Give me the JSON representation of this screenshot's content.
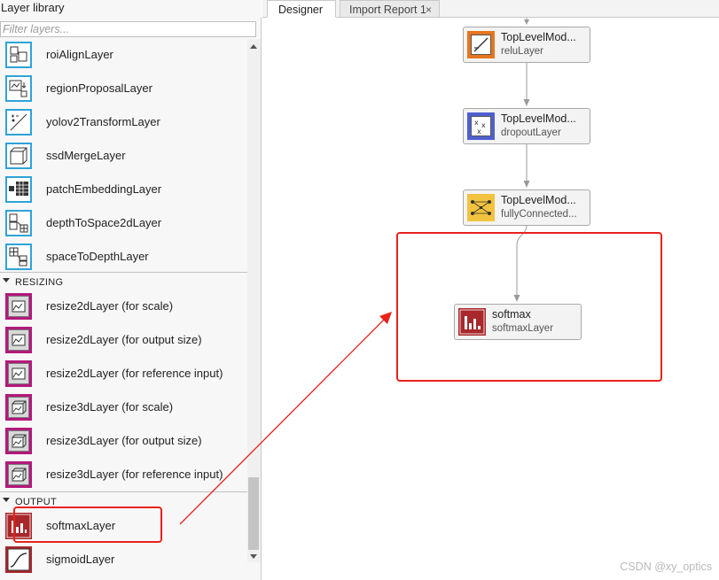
{
  "library": {
    "title": "Layer library",
    "filter_placeholder": "Filter layers..."
  },
  "items": [
    {
      "label": "roiAlignLayer",
      "icon": "roi-align-icon"
    },
    {
      "label": "regionProposalLayer",
      "icon": "region-proposal-icon"
    },
    {
      "label": "yolov2TransformLayer",
      "icon": "yolov2-transform-icon"
    },
    {
      "label": "ssdMergeLayer",
      "icon": "ssd-merge-icon"
    },
    {
      "label": "patchEmbeddingLayer",
      "icon": "patch-embedding-icon"
    },
    {
      "label": "depthToSpace2dLayer",
      "icon": "depth-to-space-icon"
    },
    {
      "label": "spaceToDepthLayer",
      "icon": "space-to-depth-icon"
    }
  ],
  "sections": {
    "resizing": "RESIZING",
    "output": "OUTPUT"
  },
  "resize_items": [
    {
      "label": "resize2dLayer (for scale)"
    },
    {
      "label": "resize2dLayer (for output size)"
    },
    {
      "label": "resize2dLayer (for reference input)"
    },
    {
      "label": "resize3dLayer (for scale)"
    },
    {
      "label": "resize3dLayer (for output size)"
    },
    {
      "label": "resize3dLayer (for reference input)"
    }
  ],
  "output_items": [
    {
      "label": "softmaxLayer"
    },
    {
      "label": "sigmoidLayer"
    }
  ],
  "tabs": {
    "designer": "Designer",
    "import": "Import Report 1",
    "close": "×"
  },
  "nodes": [
    {
      "title": "TopLevelMod...",
      "sub": "reluLayer",
      "icon": "relu-icon"
    },
    {
      "title": "TopLevelMod...",
      "sub": "dropoutLayer",
      "icon": "dropout-icon"
    },
    {
      "title": "TopLevelMod...",
      "sub": "fullyConnected...",
      "icon": "fully-connected-icon"
    },
    {
      "title": "softmax",
      "sub": "softmaxLayer",
      "icon": "softmax-icon"
    }
  ],
  "watermark": "CSDN @xy_optics",
  "colors": {
    "annotation": "#e8221b",
    "blue_icon": "#2ea3d9",
    "magenta_icon": "#b3197a",
    "red_icon": "#a8282c"
  }
}
